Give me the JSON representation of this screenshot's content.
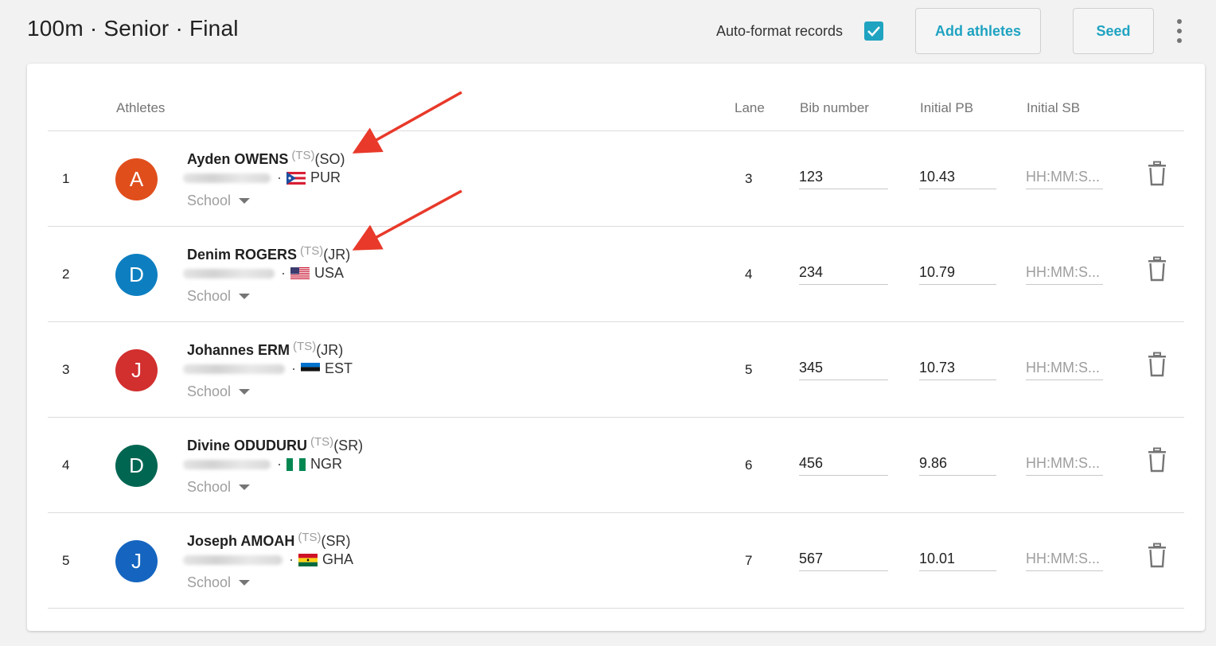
{
  "header": {
    "title": "100m · Senior · Final",
    "auto_format_label": "Auto-format records",
    "auto_format_checked": true,
    "add_athletes_label": "Add athletes",
    "seed_label": "Seed"
  },
  "columns": {
    "athletes": "Athletes",
    "lane": "Lane",
    "bib": "Bib number",
    "pb": "Initial PB",
    "sb": "Initial SB"
  },
  "colors": {
    "accent": "#1fa3c1",
    "arrow": "#e8392a"
  },
  "rows": [
    {
      "rank": "1",
      "initial": "A",
      "avatar_color": "#e04e1c",
      "name": "Ayden OWENS",
      "ts": "(TS)",
      "class": "(SO)",
      "country": "PUR",
      "flag": "pur-flag",
      "school": "School",
      "lane": "3",
      "bib": "123",
      "pb": "10.43",
      "sb_placeholder": "HH:MM:S..."
    },
    {
      "rank": "2",
      "initial": "D",
      "avatar_color": "#0d7fc1",
      "name": "Denim ROGERS",
      "ts": "(TS)",
      "class": "(JR)",
      "country": "USA",
      "flag": "usa-flag",
      "school": "School",
      "lane": "4",
      "bib": "234",
      "pb": "10.79",
      "sb_placeholder": "HH:MM:S..."
    },
    {
      "rank": "3",
      "initial": "J",
      "avatar_color": "#d22f2f",
      "name": "Johannes ERM",
      "ts": "(TS)",
      "class": "(JR)",
      "country": "EST",
      "flag": "est-flag",
      "school": "School",
      "lane": "5",
      "bib": "345",
      "pb": "10.73",
      "sb_placeholder": "HH:MM:S..."
    },
    {
      "rank": "4",
      "initial": "D",
      "avatar_color": "#006652",
      "name": "Divine ODUDURU",
      "ts": "(TS)",
      "class": "(SR)",
      "country": "NGR",
      "flag": "ngr-flag",
      "school": "School",
      "lane": "6",
      "bib": "456",
      "pb": "9.86",
      "sb_placeholder": "HH:MM:S..."
    },
    {
      "rank": "5",
      "initial": "J",
      "avatar_color": "#1565c0",
      "name": "Joseph AMOAH",
      "ts": "(TS)",
      "class": "(SR)",
      "country": "GHA",
      "flag": "gha-flag",
      "school": "School",
      "lane": "7",
      "bib": "567",
      "pb": "10.01",
      "sb_placeholder": "HH:MM:S..."
    }
  ]
}
